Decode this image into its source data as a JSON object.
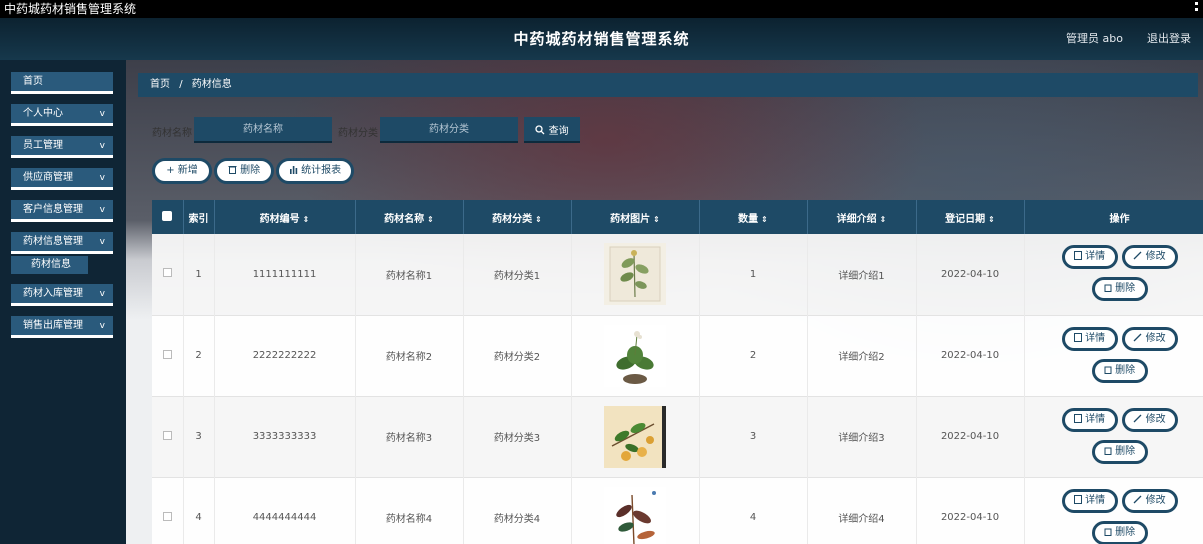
{
  "window": {
    "title": "中药城药材销售管理系统"
  },
  "header": {
    "title": "中药城药材销售管理系统",
    "user_label": "管理员 abo",
    "logout_label": "退出登录"
  },
  "sidebar": {
    "items": [
      {
        "label": "首页",
        "has_children": false
      },
      {
        "label": "个人中心",
        "has_children": true
      },
      {
        "label": "员工管理",
        "has_children": true
      },
      {
        "label": "供应商管理",
        "has_children": true
      },
      {
        "label": "客户信息管理",
        "has_children": true
      },
      {
        "label": "药材信息管理",
        "has_children": true
      },
      {
        "label": "药材入库管理",
        "has_children": true
      },
      {
        "label": "销售出库管理",
        "has_children": true
      }
    ],
    "active_sub": "药材信息",
    "chevron": "v"
  },
  "breadcrumb": {
    "home": "首页",
    "sep": "/",
    "current": "药材信息"
  },
  "search": {
    "name_label": "药材名称",
    "name_placeholder": "药材名称",
    "category_label": "药材分类",
    "category_placeholder": "药材分类",
    "button_label": "查询",
    "button_icon": "search-icon"
  },
  "actions": {
    "add": "+ 新增",
    "delete": "删除",
    "stats": "统计报表"
  },
  "table": {
    "headers": [
      "索引",
      "药材编号",
      "药材名称",
      "药材分类",
      "药材图片",
      "数量",
      "详细介绍",
      "登记日期",
      "操作"
    ],
    "sort_marker": "⇕",
    "rows": [
      {
        "index": "1",
        "code": "1111111111",
        "name": "药材名称1",
        "category": "药材分类1",
        "qty": "1",
        "detail": "详细介绍1",
        "date": "2022-04-10",
        "image": "herb-illustration-1"
      },
      {
        "index": "2",
        "code": "2222222222",
        "name": "药材名称2",
        "category": "药材分类2",
        "qty": "2",
        "detail": "详细介绍2",
        "date": "2022-04-10",
        "image": "herb-illustration-2"
      },
      {
        "index": "3",
        "code": "3333333333",
        "name": "药材名称3",
        "category": "药材分类3",
        "qty": "3",
        "detail": "详细介绍3",
        "date": "2022-04-10",
        "image": "herb-illustration-3"
      },
      {
        "index": "4",
        "code": "4444444444",
        "name": "药材名称4",
        "category": "药材分类4",
        "qty": "4",
        "detail": "详细介绍4",
        "date": "2022-04-10",
        "image": "herb-illustration-4"
      }
    ],
    "row_actions": {
      "detail": "详情",
      "edit": "修改",
      "delete": "删除"
    }
  },
  "colors": {
    "primary": "#1e4a66",
    "sidebar_item": "#2a5a7c",
    "background": "#0f2535"
  }
}
